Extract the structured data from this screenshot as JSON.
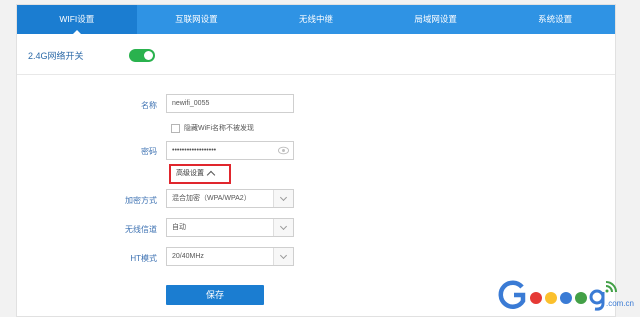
{
  "tabs": [
    "WIFI设置",
    "互联网设置",
    "无线中继",
    "局域网设置",
    "系统设置"
  ],
  "wifi_switch": {
    "label": "2.4G网络开关",
    "on": true
  },
  "form": {
    "name_label": "名称",
    "name_value": "newifi_0055",
    "hide_label": "隐藏WiFi名称不被发现",
    "password_label": "密码",
    "password_value": "••••••••••••••••••",
    "advanced_label": "高级设置",
    "encryption_label": "加密方式",
    "encryption_value": "混合加密（WPA/WPA2）",
    "channel_label": "无线信道",
    "channel_value": "自动",
    "ht_label": "HT模式",
    "ht_value": "20/40MHz",
    "save_label": "保存"
  },
  "watermark": {
    "suffix": ".com.cn"
  },
  "colors": {
    "tab_bar": "#2f93e4",
    "tab_active": "#1b7dd1",
    "toggle_on": "#2ab24e",
    "highlight_border": "#e0262d"
  }
}
